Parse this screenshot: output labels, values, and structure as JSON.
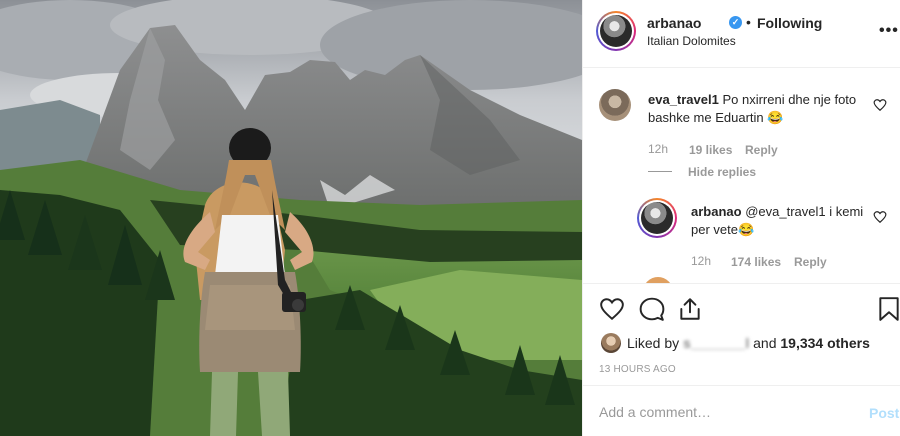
{
  "post": {
    "image_alt_icon": "landscape-photo"
  },
  "header": {
    "username": "arbanao",
    "verified_glyph": "✓",
    "separator": "•",
    "follow_status": "Following",
    "location": "Italian Dolomites",
    "more_glyph": "•••"
  },
  "comments": [
    {
      "username": "eva_travel1",
      "text": " Po nxirreni dhe nje foto bashke me Eduartin 😂",
      "time": "12h",
      "likes": "19 likes",
      "reply_label": "Reply"
    },
    {
      "username": "arbanao",
      "text": " @eva_travel1 i kemi per vete😂",
      "time": "12h",
      "likes": "174 likes",
      "reply_label": "Reply"
    }
  ],
  "hide_replies_label": "Hide replies",
  "likes_summary": {
    "prefix": "Liked by ",
    "obscured_user": "s_______l",
    "middle": " and ",
    "others": "19,334 others"
  },
  "timestamp": "13 HOURS AGO",
  "add_comment": {
    "placeholder": "Add a comment…",
    "post_label": "Post"
  },
  "colors": {
    "accent_blue": "#3897f0",
    "post_disabled": "#b2dffc",
    "muted": "#999999"
  },
  "icons": [
    "heart-icon",
    "comment-icon",
    "share-icon",
    "bookmark-icon",
    "more-options-icon",
    "verified-badge-icon"
  ]
}
